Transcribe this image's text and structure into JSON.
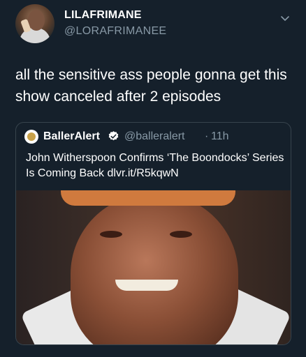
{
  "tweet": {
    "display_name": "LILAFRIMANE",
    "handle": "@LORAFRIMANEE",
    "text": "all the sensitive ass people gonna get this show canceled after 2 episodes",
    "avatar_icon": "user-avatar"
  },
  "quoted_tweet": {
    "display_name": "BallerAlert",
    "handle": "@balleralert",
    "separator": "·",
    "time": "11h",
    "text": "John Witherspoon Confirms ‘The Boondocks’ Series Is Coming Back dlvr.it/R5kqwN",
    "verified_icon": "verified-badge-icon",
    "image_icon": "photo"
  },
  "colors": {
    "background": "#15202b",
    "border": "#38444d",
    "secondary_text": "#8899a6",
    "verified": "#ffffff"
  }
}
